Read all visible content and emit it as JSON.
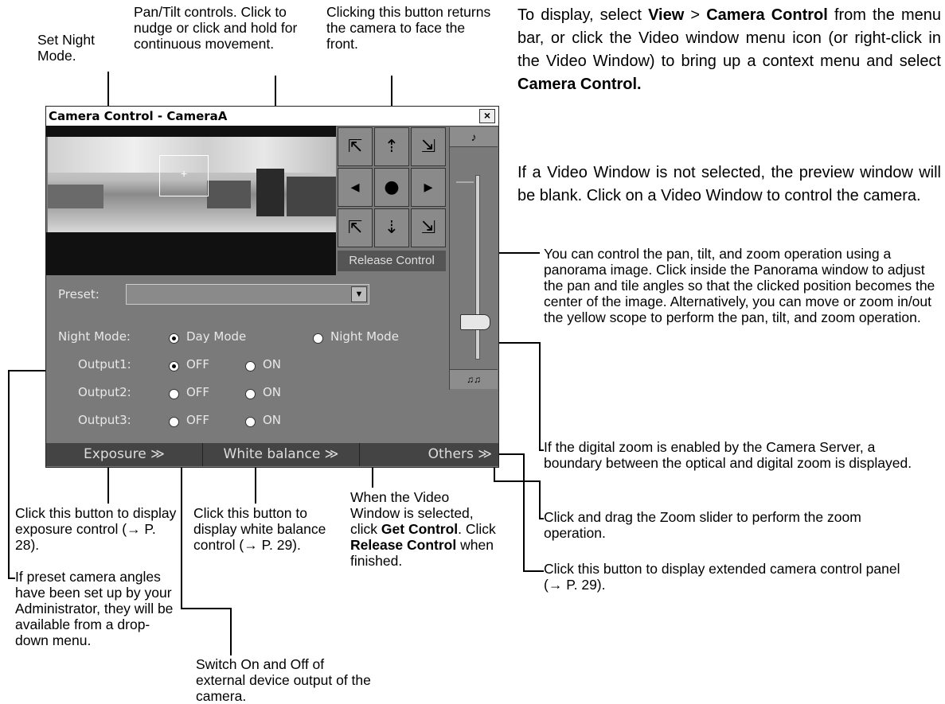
{
  "window": {
    "title": "Camera Control - CameraA",
    "close": "×",
    "release_control": "Release Control",
    "preset_label": "Preset:",
    "preset_value": "",
    "night_mode_label": "Night Mode:",
    "day_mode": "Day Mode",
    "night_mode": "Night Mode",
    "night_mode_selected": "Day Mode",
    "outputs": [
      {
        "label": "Output1:",
        "off": "OFF",
        "on": "ON",
        "selected": "OFF"
      },
      {
        "label": "Output2:",
        "off": "OFF",
        "on": "ON",
        "selected": "none"
      },
      {
        "label": "Output3:",
        "off": "OFF",
        "on": "ON",
        "selected": "none"
      }
    ],
    "tabs": {
      "exposure": "Exposure ≫",
      "white_balance": "White balance ≫",
      "others": "Others ≫"
    },
    "zoom_top": "♪",
    "zoom_bottom": "♫♫"
  },
  "annotations": {
    "night_mode": "Set Night Mode.",
    "pan_tilt": "Pan/Tilt controls. Click to nudge or click and hold for continuous movement.",
    "center_button": "Clicking this button returns the camera to face the front.",
    "panorama": "You can control the pan, tilt, and zoom operation using a panorama image. Click inside the Panorama window to adjust the pan and tile angles so that the clicked position becomes the center of the image. Alternatively, you can move or zoom in/out the yellow scope to perform the pan, tilt, and zoom operation.",
    "digital_zoom": "If the digital zoom is enabled by the Camera Server, a boundary between the optical and digital zoom is displayed.",
    "zoom_slider": "Click and drag the Zoom slider to perform the zoom operation.",
    "others": "Click this button to display extended camera control panel (→ P. 29).",
    "exposure": "Click this button to display exposure control (→ P. 28).",
    "white_balance": "Click this button to display white balance control (→ P. 29).",
    "get_control_1": "When the Video Window is selected, click",
    "get_control_bold": "Get Control",
    "get_control_2": ". Click",
    "release_bold": "Release Control",
    "get_control_3": "when finished.",
    "preset": "If preset camera angles have been set up by your Administrator, they will be available from a drop-down menu.",
    "outputs": "Switch On and Off of external device output of the camera."
  },
  "intro": {
    "p1_a": "To display, select",
    "p1_view": "View",
    "p1_gt": ">",
    "p1_cc": "Camera Control",
    "p1_b": "from the menu bar, or click the Video window menu icon (or right-click in the Video Window) to bring up a context menu and select",
    "p1_cc2": "Camera Control.",
    "p2": "If a Video Window is not selected, the preview window will be blank. Click on a Video Window to control the camera."
  }
}
